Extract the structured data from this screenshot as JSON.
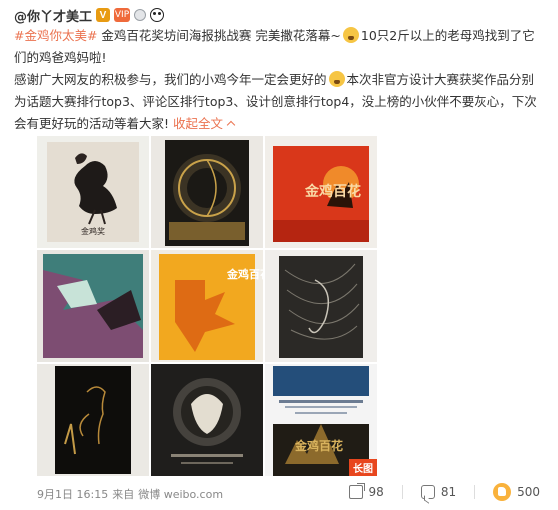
{
  "author": {
    "name": "@你丫才美工",
    "badges": [
      "verified-v-icon",
      "vip-icon",
      "medal-icon",
      "panda-icon"
    ],
    "verified_label": "V",
    "vip_label": "VIP"
  },
  "post": {
    "hashtag": "#金鸡你太美#",
    "line1_after_tag": " 金鸡百花奖坊间海报挑战赛 完美撒花落幕~",
    "line1_after_emoji": "10只2斤以上的老母鸡找到了它们的鸡爸鸡妈啦!",
    "para2_before_emoji": "感谢广大网友的积极参与，我们的小鸡今年一定会更好的",
    "para2_after_emoji": "本次非官方设计大赛获奖作品分别为话题大赛排行top3、评论区排行top3、设计创意排行top4，没上榜的小伙伴不要灰心，下次会有更好玩的活动等着大家!",
    "collapse_label": "收起全文"
  },
  "images": [
    {
      "id": "poster-1",
      "caption": "金鸡奖"
    },
    {
      "id": "poster-2",
      "caption": ""
    },
    {
      "id": "poster-3",
      "caption": "金鸡百花"
    },
    {
      "id": "poster-4",
      "caption": ""
    },
    {
      "id": "poster-5",
      "caption": "金鸡百花"
    },
    {
      "id": "poster-6",
      "caption": ""
    },
    {
      "id": "poster-7",
      "caption": ""
    },
    {
      "id": "poster-8",
      "caption": ""
    },
    {
      "id": "poster-9",
      "caption": "金鸡百花"
    }
  ],
  "long_image_tag": "长图",
  "footer": {
    "date": "9月1日 16:15",
    "source_prefix": "来自",
    "source": "微博 weibo.com",
    "share_count": "98",
    "comment_count": "81",
    "like_count": "500"
  },
  "colors": {
    "link": "#eb7350",
    "like": "#f9b23c",
    "long_tag": "#e8461e"
  }
}
